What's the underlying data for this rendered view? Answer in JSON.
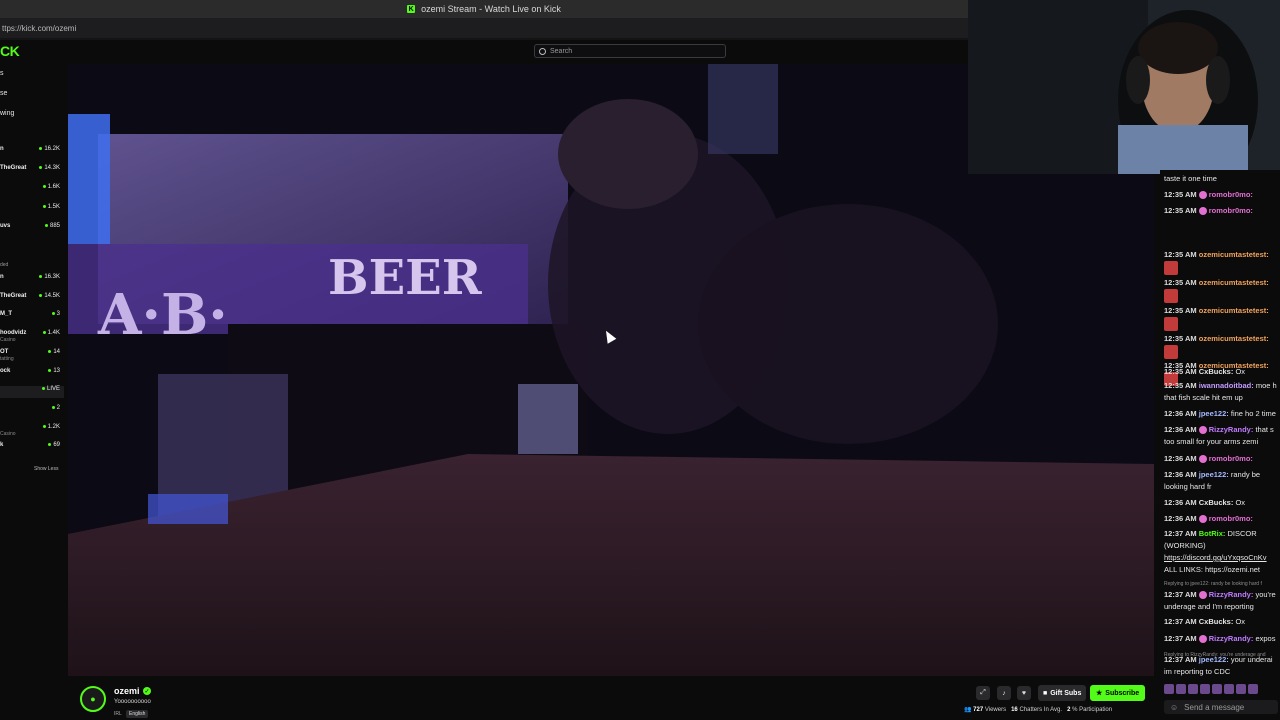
{
  "browser": {
    "tab_title": "ozemi Stream - Watch Live on Kick",
    "url": "ttps://kick.com/ozemi"
  },
  "header": {
    "logo": "CK",
    "search_placeholder": "Search"
  },
  "sidebar": {
    "nav": [
      "s",
      "se",
      "wing"
    ],
    "following": [
      {
        "name": "n",
        "count": "16.2K"
      },
      {
        "name": "TheGreat",
        "count": "14.3K"
      },
      {
        "name": "",
        "count": "1.6K"
      },
      {
        "name": "",
        "count": "1.5K"
      },
      {
        "name": "uvs",
        "count": "885"
      }
    ],
    "section_label": "ded",
    "recommended": [
      {
        "name": "n",
        "sub": "",
        "count": "16.3K"
      },
      {
        "name": "TheGreat",
        "sub": "",
        "count": "14.5K"
      },
      {
        "name": "M_T",
        "sub": "",
        "count": "3"
      },
      {
        "name": "hoodvidz",
        "sub": "Casino",
        "count": "1.4K"
      },
      {
        "name": "OT",
        "sub": "tatting",
        "count": "14"
      },
      {
        "name": "ock",
        "sub": "",
        "count": "13"
      },
      {
        "name": "",
        "sub": "",
        "count": "LIVE"
      },
      {
        "name": "",
        "sub": "",
        "count": "2"
      },
      {
        "name": "",
        "sub": "Casino",
        "count": "1.2K"
      },
      {
        "name": "k",
        "sub": "",
        "count": "69"
      }
    ],
    "show_less": "Show Less"
  },
  "chat": {
    "messages": [
      {
        "ts": "",
        "user": "",
        "text": "taste it one time",
        "color": "#e6e6e6"
      },
      {
        "ts": "12:35 AM",
        "user": "romobr0mo:",
        "text": "",
        "color": "#e36fd1",
        "badge": true
      },
      {
        "ts": "12:35 AM",
        "user": "romobr0mo:",
        "text": "",
        "color": "#e36fd1",
        "badge": true
      },
      {
        "ts": "12:35 AM",
        "user": "ozemicumtastetest:",
        "text": "",
        "color": "#f2a35b"
      },
      {
        "ts": "12:35 AM",
        "user": "ozemicumtastetest:",
        "text": "",
        "color": "#f2a35b"
      },
      {
        "ts": "12:35 AM",
        "user": "ozemicumtastetest:",
        "text": "",
        "color": "#f2a35b"
      },
      {
        "ts": "12:35 AM",
        "user": "ozemicumtastetest:",
        "text": "",
        "color": "#f2a35b"
      },
      {
        "ts": "12:35 AM",
        "user": "ozemicumtastetest:",
        "text": "",
        "color": "#f2a35b"
      },
      {
        "ts": "12:35 AM",
        "user": "CxBucks:",
        "text": "Ox",
        "color": "#e6e6e6"
      },
      {
        "ts": "12:35 AM",
        "user": "iwannadoitbad:",
        "text": "moe h",
        "color": "#c49cff"
      },
      {
        "ts": "",
        "user": "",
        "text": "that fish scale hit em up",
        "color": "#e6e6e6"
      },
      {
        "ts": "12:36 AM",
        "user": "jpee122:",
        "text": "fine ho 2 time",
        "color": "#a4b8ff"
      },
      {
        "ts": "12:36 AM",
        "user": "RizzyRandy:",
        "text": "that s",
        "color": "#c07cff",
        "badge": true
      },
      {
        "ts": "",
        "user": "",
        "text": "too small for your arms zemi",
        "color": "#e6e6e6"
      },
      {
        "ts": "12:36 AM",
        "user": "romobr0mo:",
        "text": "",
        "color": "#e36fd1",
        "badge": true
      },
      {
        "ts": "12:36 AM",
        "user": "jpee122:",
        "text": "randy be",
        "color": "#a4b8ff"
      },
      {
        "ts": "",
        "user": "",
        "text": "looking hard fr",
        "color": "#e6e6e6"
      },
      {
        "ts": "12:36 AM",
        "user": "CxBucks:",
        "text": "Ox",
        "color": "#e6e6e6"
      },
      {
        "ts": "12:36 AM",
        "user": "romobr0mo:",
        "text": "",
        "color": "#e36fd1",
        "badge": true
      },
      {
        "ts": "12:37 AM",
        "user": "BotRix:",
        "text": "DISCOR",
        "color": "#53fc18"
      },
      {
        "ts": "",
        "user": "",
        "text": "(WORKING)",
        "color": "#e6e6e6"
      },
      {
        "ts": "",
        "user": "",
        "text": "https://discord.gg/uYxqsoCnKv",
        "color": "#e6e6e6",
        "link": true
      },
      {
        "ts": "",
        "user": "",
        "text": "ALL LINKS: https://ozemi.net",
        "color": "#e6e6e6"
      },
      {
        "ts": "",
        "user": "",
        "text": "Replying to jpee122: randy be looking hard f",
        "color": "#8d8d8d",
        "reply": true
      },
      {
        "ts": "12:37 AM",
        "user": "RizzyRandy:",
        "text": "you're",
        "color": "#c07cff",
        "badge": true
      },
      {
        "ts": "",
        "user": "",
        "text": "underage and I'm reporting",
        "color": "#e6e6e6"
      },
      {
        "ts": "12:37 AM",
        "user": "CxBucks:",
        "text": "Ox",
        "color": "#e6e6e6"
      },
      {
        "ts": "12:37 AM",
        "user": "RizzyRandy:",
        "text": "expos",
        "color": "#c07cff",
        "badge": true
      },
      {
        "ts": "",
        "user": "",
        "text": "Replying to RizzyRandy: you're underage and",
        "color": "#8d8d8d",
        "reply": true
      },
      {
        "ts": "12:37 AM",
        "user": "jpee122:",
        "text": "your underai",
        "color": "#a4b8ff"
      },
      {
        "ts": "",
        "user": "",
        "text": "im reporting to CDC",
        "color": "#e6e6e6"
      }
    ],
    "input_placeholder": "Send a message"
  },
  "streamer": {
    "name": "ozemi",
    "title": "Yoooooooooo",
    "category": "IRL",
    "language": "English"
  },
  "actions": {
    "gift_label": "Gift Subs",
    "subscribe_label": "Subscribe"
  },
  "stats": {
    "viewers_count": "727",
    "viewers_label": "Viewers",
    "chatters_count": "16",
    "chatters_label": "Chatters In Avg.",
    "participation_count": "2",
    "participation_label": "% Participation"
  },
  "colors": {
    "accent": "#53fc18",
    "background": "#0b0b0c"
  }
}
